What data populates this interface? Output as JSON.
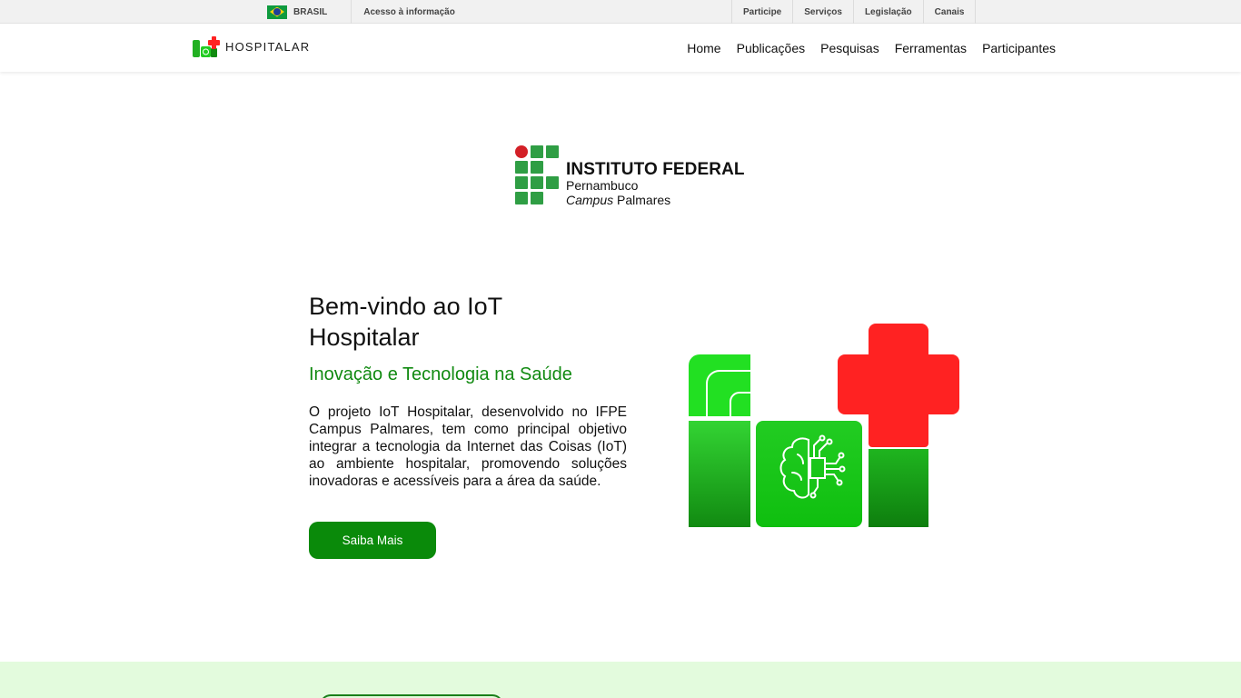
{
  "gov_bar": {
    "country": "BRASIL",
    "access_link": "Acesso à informação",
    "links": [
      "Participe",
      "Serviços",
      "Legislação",
      "Canais"
    ]
  },
  "nav": {
    "logo_text": "HOSPITALAR",
    "menu": [
      "Home",
      "Publicações",
      "Pesquisas",
      "Ferramentas",
      "Participantes"
    ]
  },
  "institution": {
    "title": "INSTITUTO FEDERAL",
    "state": "Pernambuco",
    "campus_word": "Campus",
    "campus_name": " Palmares"
  },
  "hero": {
    "title": "Bem-vindo ao IoT Hospitalar",
    "subtitle": "Inovação e Tecnologia na Saúde",
    "description": "O projeto IoT Hospitalar, desenvolvido no IFPE Campus Palmares, tem como principal objetivo integrar a tecnologia da Internet das Coisas (IoT) ao ambiente hospitalar, promovendo soluções inovadoras e acessíveis para a área da saúde.",
    "button": "Saiba Mais"
  },
  "colors": {
    "brand_green": "#0a8a0a",
    "accent_red": "#ff2222",
    "subtitle_green": "#118a11",
    "band_green": "#e3fbdd"
  }
}
